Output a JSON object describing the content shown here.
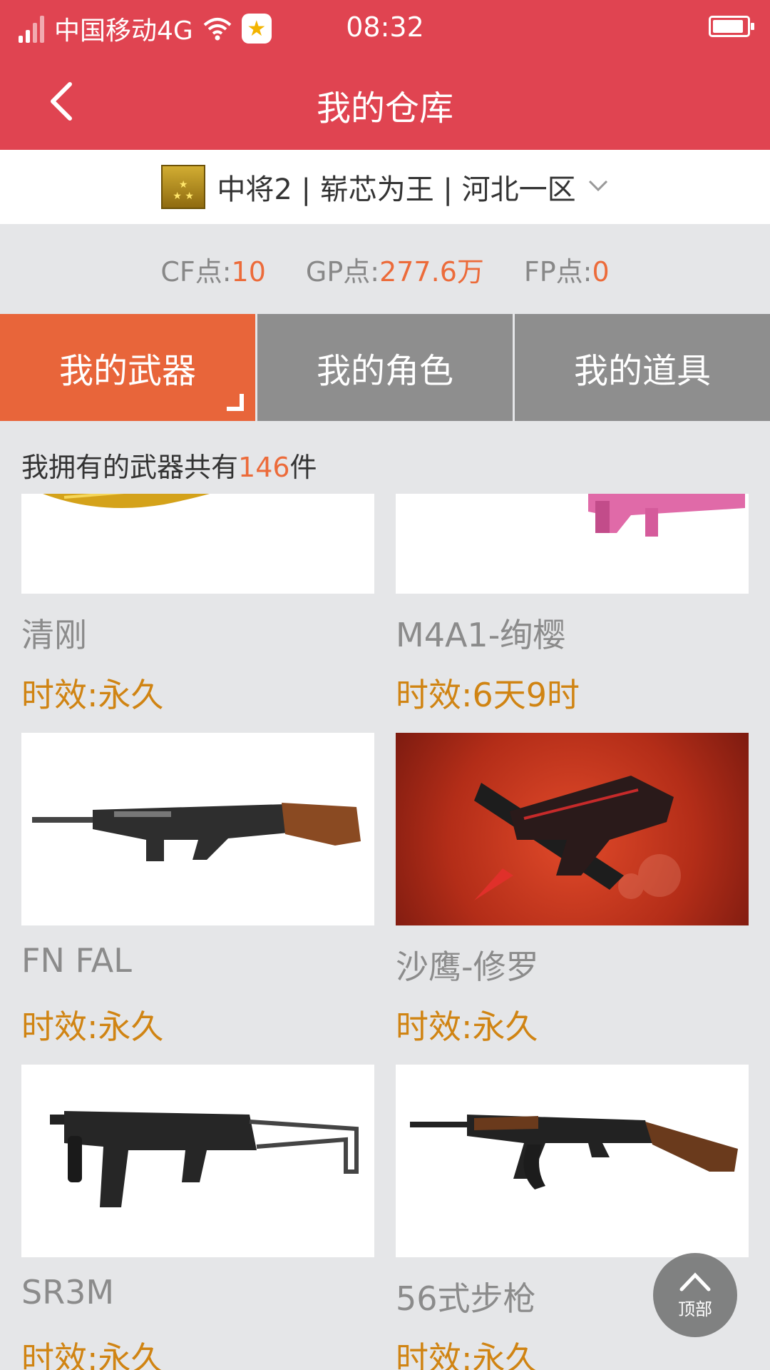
{
  "status": {
    "carrier": "中国移动4G",
    "time": "08:32",
    "qq_icon": "qq-star-icon"
  },
  "nav": {
    "title": "我的仓库",
    "back_icon": "chevron-left-icon"
  },
  "account": {
    "label": "中将2 | 崭芯为王 | 河北一区"
  },
  "points": [
    {
      "label": "CF点:",
      "value": "10"
    },
    {
      "label": "GP点:",
      "value": "277.6万"
    },
    {
      "label": "FP点:",
      "value": "0"
    }
  ],
  "tabs": [
    {
      "label": "我的武器",
      "active": true
    },
    {
      "label": "我的角色",
      "active": false
    },
    {
      "label": "我的道具",
      "active": false
    }
  ],
  "count": {
    "prefix": "我拥有的武器共有",
    "number": "146",
    "suffix": "件"
  },
  "items": [
    {
      "name": "清刚",
      "time": "时效:永久",
      "thumb": "gold-knife"
    },
    {
      "name": "M4A1-绚樱",
      "time": "时效:6天9时",
      "thumb": "pink-rifle"
    },
    {
      "name": "FN FAL",
      "time": "时效:永久",
      "thumb": "fn-fal"
    },
    {
      "name": "沙鹰-修罗",
      "time": "时效:永久",
      "thumb": "desert-eagle-red"
    },
    {
      "name": "SR3M",
      "time": "时效:永久",
      "thumb": "sr3m"
    },
    {
      "name": "56式步枪",
      "time": "时效:永久",
      "thumb": "type56"
    }
  ],
  "top_button": {
    "label": "顶部"
  },
  "colors": {
    "header": "#e04451",
    "accent": "#ec6b3a",
    "tab_active": "#e8653a",
    "tab_inactive": "#8e8e8e",
    "time_text": "#d08413"
  }
}
